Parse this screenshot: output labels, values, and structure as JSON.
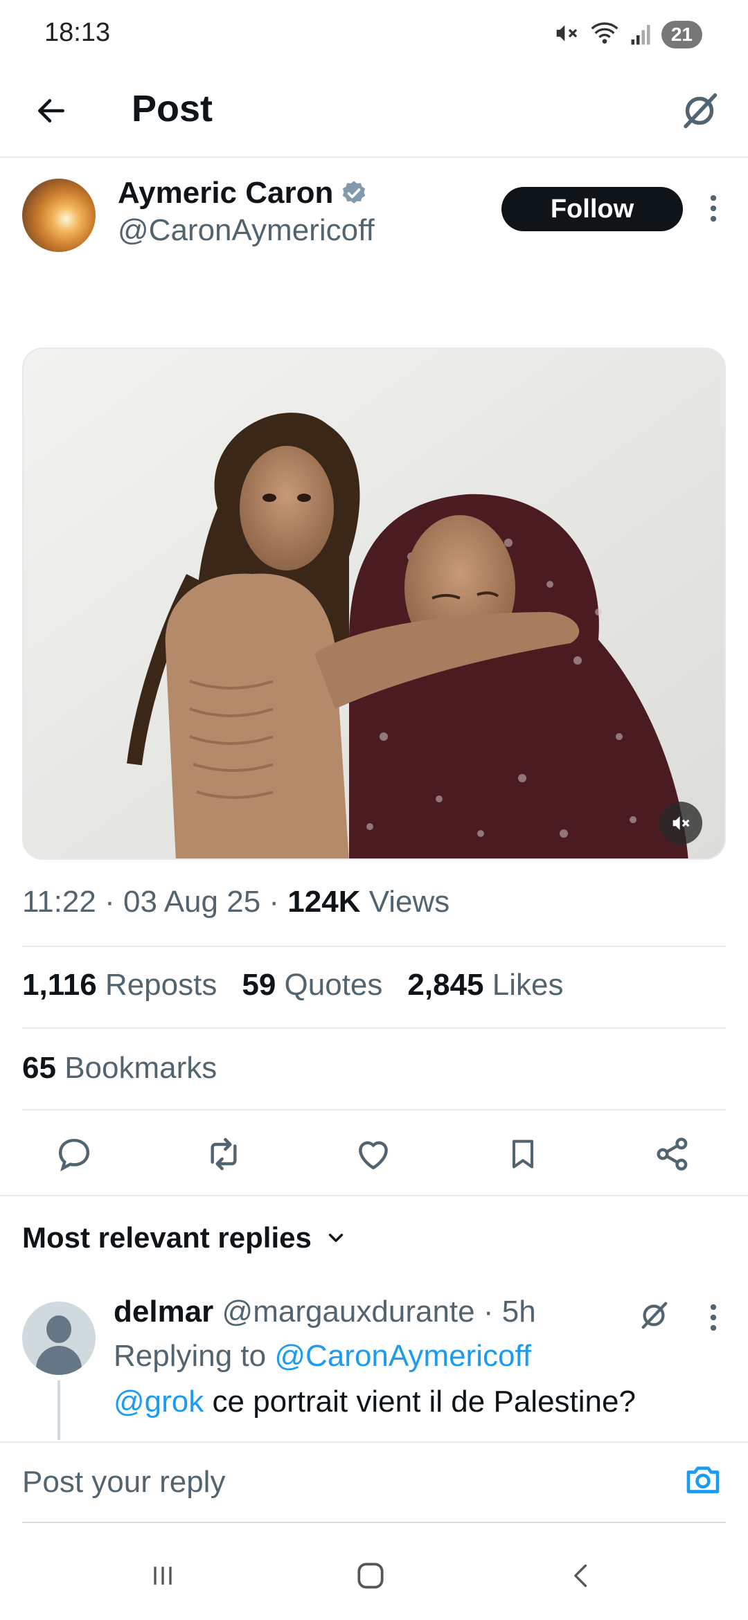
{
  "status_bar": {
    "time": "18:13",
    "battery": "21",
    "icons": [
      "mute-icon",
      "wifi-icon",
      "signal-icon",
      "battery-icon"
    ]
  },
  "header": {
    "title": "Post",
    "back_icon": "arrow-left-icon",
    "grok_icon": "grok-icon"
  },
  "author": {
    "name": "Aymeric Caron",
    "handle": "@CaronAymericoff",
    "verified": true,
    "follow_label": "Follow"
  },
  "media": {
    "mute_icon": "volume-muted-icon"
  },
  "meta": {
    "time": "11:22",
    "date": "03 Aug 25",
    "separator": "·",
    "views_count": "124K",
    "views_label": "Views"
  },
  "stats": {
    "reposts_count": "1,116",
    "reposts_label": "Reposts",
    "quotes_count": "59",
    "quotes_label": "Quotes",
    "likes_count": "2,845",
    "likes_label": "Likes",
    "bookmarks_count": "65",
    "bookmarks_label": "Bookmarks"
  },
  "actions": [
    "reply-icon",
    "repost-icon",
    "like-icon",
    "bookmark-icon",
    "share-icon"
  ],
  "replies": {
    "sort_label": "Most relevant replies",
    "items": [
      {
        "name": "delmar",
        "handle": "@margauxdurante",
        "separator": "·",
        "age": "5h",
        "replying_prefix": "Replying to",
        "replying_to": "@CaronAymericoff",
        "mention": "@grok",
        "text": "ce portrait vient il de Palestine?"
      }
    ]
  },
  "composer": {
    "placeholder": "Post your reply"
  },
  "colors": {
    "text": "#0f1419",
    "secondary": "#536471",
    "link": "#1d9bf0",
    "divider": "#e6e9ec"
  }
}
